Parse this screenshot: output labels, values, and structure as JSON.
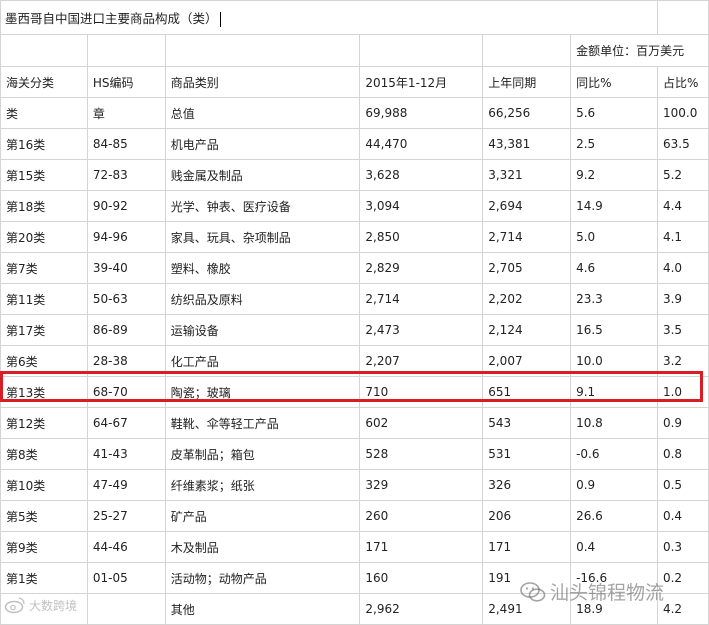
{
  "title": "墨西哥自中国进口主要商品构成（类）",
  "unit": "金额单位：百万美元",
  "headers": [
    "海关分类",
    "HS编码",
    "商品类别",
    "2015年1-12月",
    "上年同期",
    "同比%",
    "占比%"
  ],
  "rows": [
    [
      "类",
      "章",
      "总值",
      "69,988",
      "66,256",
      "5.6",
      "100.0"
    ],
    [
      "第16类",
      "84-85",
      "机电产品",
      "44,470",
      "43,381",
      "2.5",
      "63.5"
    ],
    [
      "第15类",
      "72-83",
      "贱金属及制品",
      "3,628",
      "3,321",
      "9.2",
      "5.2"
    ],
    [
      "第18类",
      "90-92",
      "光学、钟表、医疗设备",
      "3,094",
      "2,694",
      "14.9",
      "4.4"
    ],
    [
      "第20类",
      "94-96",
      "家具、玩具、杂项制品",
      "2,850",
      "2,714",
      "5.0",
      "4.1"
    ],
    [
      "第7类",
      "39-40",
      "塑料、橡胶",
      "2,829",
      "2,705",
      "4.6",
      "4.0"
    ],
    [
      "第11类",
      "50-63",
      "纺织品及原料",
      "2,714",
      "2,202",
      "23.3",
      "3.9"
    ],
    [
      "第17类",
      "86-89",
      "运输设备",
      "2,473",
      "2,124",
      "16.5",
      "3.5"
    ],
    [
      "第6类",
      "28-38",
      "化工产品",
      "2,207",
      "2,007",
      "10.0",
      "3.2"
    ],
    [
      "第13类",
      "68-70",
      "陶瓷；玻璃",
      "710",
      "651",
      "9.1",
      "1.0"
    ],
    [
      "第12类",
      "64-67",
      "鞋靴、伞等轻工产品",
      "602",
      "543",
      "10.8",
      "0.9"
    ],
    [
      "第8类",
      "41-43",
      "皮革制品；箱包",
      "528",
      "531",
      "-0.6",
      "0.8"
    ],
    [
      "第10类",
      "47-49",
      "纤维素浆；纸张",
      "329",
      "326",
      "0.9",
      "0.5"
    ],
    [
      "第5类",
      "25-27",
      "矿产品",
      "260",
      "206",
      "26.6",
      "0.4"
    ],
    [
      "第9类",
      "44-46",
      "木及制品",
      "171",
      "171",
      "0.4",
      "0.3"
    ],
    [
      "第1类",
      "01-05",
      "活动物；动物产品",
      "160",
      "191",
      "-16.6",
      "0.2"
    ],
    [
      "",
      "",
      "其他",
      "2,962",
      "2,491",
      "18.9",
      "4.2"
    ]
  ],
  "highlight_color": "#d81e22",
  "watermark_right": "汕头锦程物流",
  "watermark_right_icon": "wechat-icon",
  "watermark_left": "大数跨境",
  "watermark_left_icon": "weibo-icon"
}
